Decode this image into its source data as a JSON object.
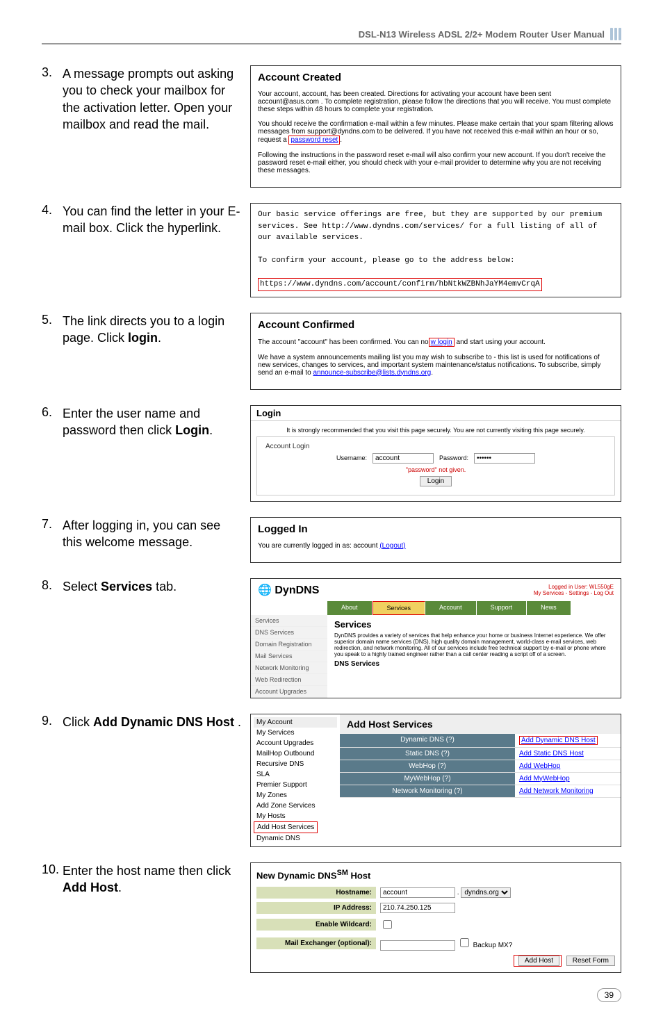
{
  "header": {
    "title": "DSL-N13 Wireless ADSL 2/2+ Modem Router User Manual"
  },
  "steps": [
    {
      "num": "3.",
      "text": "A message prompts out asking you to check your mailbox for the activation letter. Open your mailbox and read the mail."
    },
    {
      "num": "4.",
      "text": "You can find the letter in your E-mail box. Click the hyperlink."
    },
    {
      "num": "5.",
      "text": "The link directs you to a login page. Click login."
    },
    {
      "num": "6.",
      "text": "Enter the user name and password then click Login."
    },
    {
      "num": "7.",
      "text": "After logging in, you can see this welcome message."
    },
    {
      "num": "8.",
      "text": "Select Services tab."
    },
    {
      "num": "9.",
      "text": "Click Add Dynamic DNS Host ."
    },
    {
      "num": "10.",
      "text": "Enter the host name then click Add Host."
    }
  ],
  "box3": {
    "title": "Account Created",
    "p1": "Your account, account, has been created. Directions for activating your account have been sent account@asus.com . To complete registration, please follow the directions that you will receive. You must complete these steps within 48 hours to complete your registration.",
    "p2a": "You should receive the confirmation e-mail within a few minutes. Please make certain that your spam filtering allows messages from support@dyndns.com to be delivered. If you have not received this e-mail within an hour or so, request a ",
    "p2link": "password reset",
    "p3": "Following the instructions in the password reset e-mail will also confirm your new account. If you don't receive the password reset e-mail either, you should check with your e-mail provider to determine why you are not receiving these messages."
  },
  "box4": {
    "p1": "Our basic service offerings are free, but they are supported by our premium services.  See http://www.dyndns.com/services/ for a full listing of all of our available services.",
    "p2": "To confirm your account, please go to the address below:",
    "link": "https://www.dyndns.com/account/confirm/hbNtkWZBNhJaYM4emvCrqA"
  },
  "box5": {
    "title": "Account Confirmed",
    "p1a": "The account \"account\" has been confirmed. You can no",
    "p1link": "w login",
    "p1b": "and start using your account.",
    "p2a": "We have a system announcements mailing list you may wish to subscribe to - this list is used for notifications of new services, changes to services, and important system maintenance/status notifications. To subscribe, simply send an e-mail to ",
    "p2link": "announce-subscribe@lists.dyndns.org"
  },
  "box6": {
    "title": "Login",
    "warn": "It is strongly recommended that you visit this page securely. You are not currently visiting this page securely.",
    "legend": "Account Login",
    "user_label": "Username:",
    "user_val": "account",
    "pass_label": "Password:",
    "pass_val": "••••••",
    "err": "\"password\" not given.",
    "btn": "Login"
  },
  "box7": {
    "title": "Logged In",
    "msg": "You are currently logged in as: account ",
    "logout": "(Logout)"
  },
  "box8": {
    "logo": "DynDNS",
    "logged": "Logged in User: WL550gE",
    "links": "My Services - Settings - Log Out",
    "tabs": [
      "About",
      "Services",
      "Account",
      "Support",
      "News"
    ],
    "side": [
      "Services",
      "DNS Services",
      "Domain Registration",
      "Mail Services",
      "Network Monitoring",
      "Web Redirection",
      "Account Upgrades"
    ],
    "svc_title": "Services",
    "svc_desc": "DynDNS provides a variety of services that help enhance your home or business Internet experience. We offer superior domain name services (DNS), high quality domain management, world-class e-mail services, web redirection, and network monitoring. All of our services include free technical support by e-mail or phone where you speak to a highly trained engineer rather than a call center reading a script off of a screen.",
    "dns_title": "DNS Services"
  },
  "box9": {
    "side": [
      "My Account",
      "My Services",
      "Account Upgrades",
      "MailHop Outbound",
      "Recursive DNS",
      "SLA",
      "Premier Support",
      "My Zones",
      "Add Zone Services",
      "My Hosts",
      "Add Host Services",
      "Dynamic DNS"
    ],
    "title": "Add Host Services",
    "rows": [
      {
        "label": "Dynamic DNS (?)",
        "link": "Add Dynamic DNS Host"
      },
      {
        "label": "Static DNS (?)",
        "link": "Add Static DNS Host"
      },
      {
        "label": "WebHop (?)",
        "link": "Add WebHop"
      },
      {
        "label": "MyWebHop (?)",
        "link": "Add MyWebHop"
      },
      {
        "label": "Network Monitoring (?)",
        "link": "Add Network Monitoring"
      }
    ]
  },
  "box10": {
    "title": "New Dynamic DNSSM Host",
    "rows": {
      "hostname": {
        "label": "Hostname:",
        "val": "account",
        "domain": "dyndns.org"
      },
      "ip": {
        "label": "IP Address:",
        "val": "210.74.250.125"
      },
      "wildcard": {
        "label": "Enable Wildcard:"
      },
      "mx": {
        "label": "Mail Exchanger (optional):",
        "chk": "Backup MX?"
      }
    },
    "btn_add": "Add Host",
    "btn_reset": "Reset Form"
  },
  "page_num": "39"
}
